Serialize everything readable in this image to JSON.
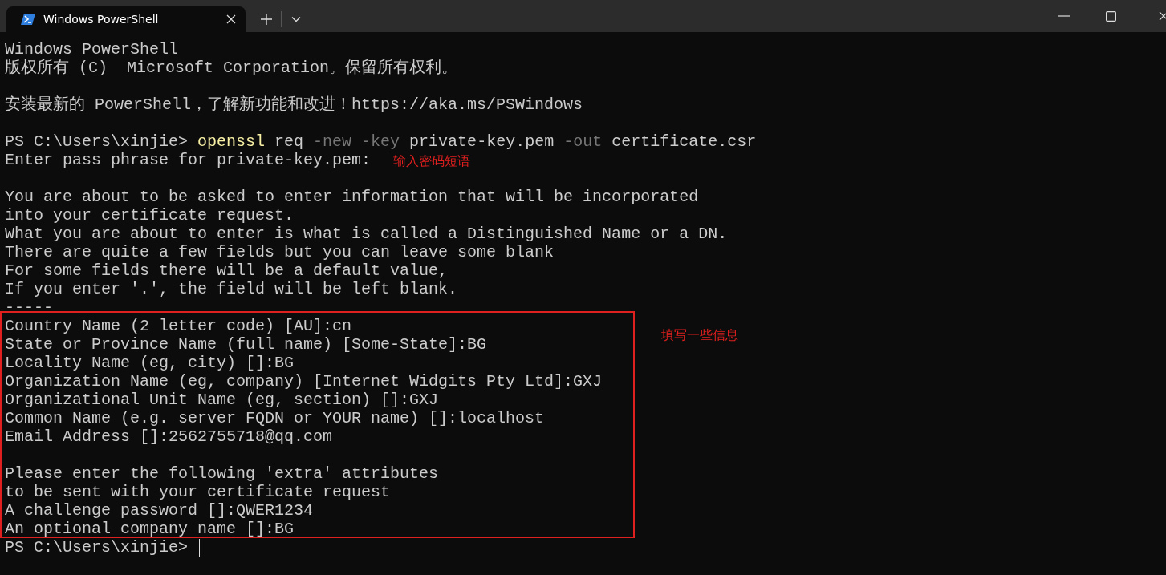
{
  "tabs": [
    {
      "title": "Windows PowerShell",
      "selected": true
    }
  ],
  "terminal": {
    "blocks": [
      {
        "lines": [
          {
            "segments": [
              {
                "kind": "plain",
                "text": "Windows PowerShell"
              }
            ]
          },
          {
            "segments": [
              {
                "kind": "plain",
                "text": "版权所有 (C)  Microsoft Corporation。保留所有权利。"
              }
            ]
          }
        ]
      },
      {
        "lines": [
          {
            "segments": [
              {
                "kind": "plain",
                "text": "安装最新的 PowerShell，了解新功能和改进！https://aka.ms/PSWindows"
              }
            ]
          }
        ]
      },
      {
        "lines": [
          {
            "segments": [
              {
                "kind": "plain",
                "text": "PS C:\\Users\\xinjie> "
              },
              {
                "kind": "command",
                "text": "openssl"
              },
              {
                "kind": "plain",
                "text": " req "
              },
              {
                "kind": "parameter",
                "text": "-new -key"
              },
              {
                "kind": "plain",
                "text": " private-key.pem "
              },
              {
                "kind": "parameter",
                "text": "-out"
              },
              {
                "kind": "plain",
                "text": " certificate.csr"
              }
            ]
          },
          {
            "segments": [
              {
                "kind": "plain",
                "text": "Enter pass phrase for private-key.pem:"
              }
            ]
          }
        ]
      },
      {
        "lines": [
          {
            "segments": [
              {
                "kind": "plain",
                "text": "You are about to be asked to enter information that will be incorporated"
              }
            ]
          },
          {
            "segments": [
              {
                "kind": "plain",
                "text": "into your certificate request."
              }
            ]
          },
          {
            "segments": [
              {
                "kind": "plain",
                "text": "What you are about to enter is what is called a Distinguished Name or a DN."
              }
            ]
          },
          {
            "segments": [
              {
                "kind": "plain",
                "text": "There are quite a few fields but you can leave some blank"
              }
            ]
          },
          {
            "segments": [
              {
                "kind": "plain",
                "text": "For some fields there will be a default value,"
              }
            ]
          },
          {
            "segments": [
              {
                "kind": "plain",
                "text": "If you enter '.', the field will be left blank."
              }
            ]
          },
          {
            "segments": [
              {
                "kind": "plain",
                "text": "-----"
              }
            ]
          },
          {
            "segments": [
              {
                "kind": "plain",
                "text": "Country Name (2 letter code) [AU]:cn"
              }
            ]
          },
          {
            "segments": [
              {
                "kind": "plain",
                "text": "State or Province Name (full name) [Some-State]:BG"
              }
            ]
          },
          {
            "segments": [
              {
                "kind": "plain",
                "text": "Locality Name (eg, city) []:BG"
              }
            ]
          },
          {
            "segments": [
              {
                "kind": "plain",
                "text": "Organization Name (eg, company) [Internet Widgits Pty Ltd]:GXJ"
              }
            ]
          },
          {
            "segments": [
              {
                "kind": "plain",
                "text": "Organizational Unit Name (eg, section) []:GXJ"
              }
            ]
          },
          {
            "segments": [
              {
                "kind": "plain",
                "text": "Common Name (e.g. server FQDN or YOUR name) []:localhost"
              }
            ]
          },
          {
            "segments": [
              {
                "kind": "plain",
                "text": "Email Address []:2562755718@qq.com"
              }
            ]
          }
        ]
      },
      {
        "lines": [
          {
            "segments": [
              {
                "kind": "plain",
                "text": "Please enter the following 'extra' attributes"
              }
            ]
          },
          {
            "segments": [
              {
                "kind": "plain",
                "text": "to be sent with your certificate request"
              }
            ]
          },
          {
            "segments": [
              {
                "kind": "plain",
                "text": "A challenge password []:QWER1234"
              }
            ]
          },
          {
            "segments": [
              {
                "kind": "plain",
                "text": "An optional company name []:BG"
              }
            ]
          },
          {
            "cursor": true,
            "segments": [
              {
                "kind": "plain",
                "text": "PS C:\\Users\\xinjie> "
              }
            ]
          }
        ]
      }
    ]
  },
  "annotations": [
    {
      "kind": "note",
      "text": "输入密码短语"
    },
    {
      "kind": "box"
    },
    {
      "kind": "note",
      "text": "填写一些信息"
    }
  ]
}
